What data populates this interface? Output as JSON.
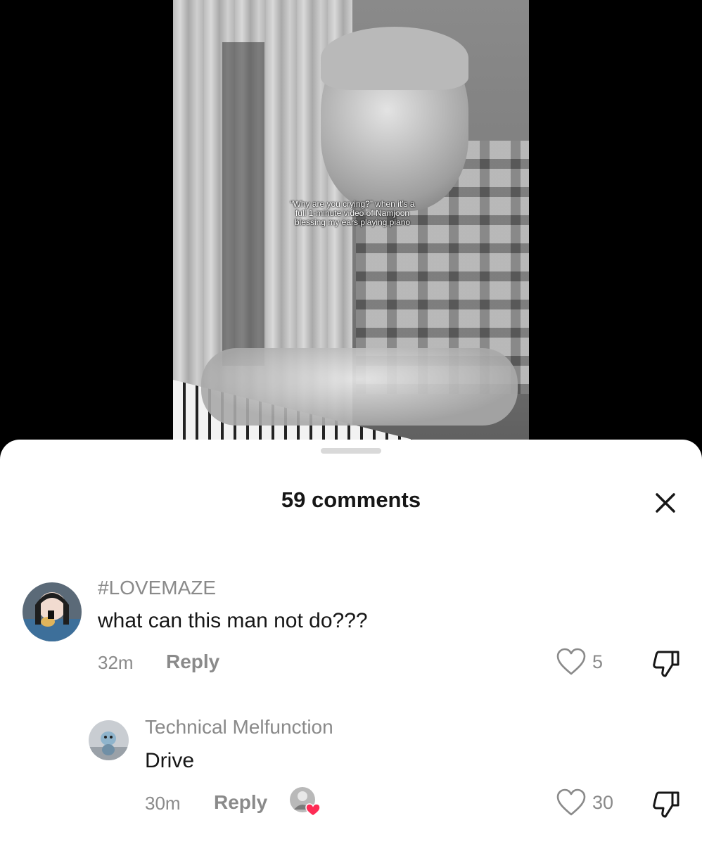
{
  "video": {
    "caption": "“Why are you crying?” when it's a full 1-minute video of Namjoon blessing my ears playing piano"
  },
  "sheet": {
    "title": "59 comments",
    "close_icon": "close-icon"
  },
  "comments": [
    {
      "username": "#LOVEMAZE",
      "text": "what can this man not do???",
      "time": "32m",
      "reply_label": "Reply",
      "likes": "5"
    },
    {
      "username": "Technical Melfunction",
      "text": "Drive",
      "time": "30m",
      "reply_label": "Reply",
      "likes": "30",
      "liked_by_creator": true
    }
  ],
  "colors": {
    "text_primary": "#161616",
    "text_secondary": "#8a8a8a",
    "creator_heart": "#fe2c55"
  }
}
